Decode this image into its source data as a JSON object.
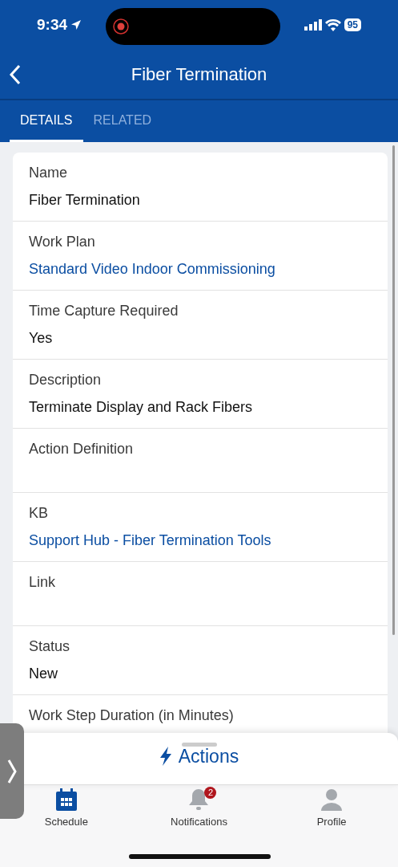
{
  "status_bar": {
    "time": "9:34",
    "battery": "95"
  },
  "header": {
    "title": "Fiber Termination"
  },
  "tabs": [
    {
      "label": "DETAILS",
      "selected": true
    },
    {
      "label": "RELATED",
      "selected": false
    }
  ],
  "fields": [
    {
      "label": "Name",
      "value": "Fiber Termination",
      "kind": "text"
    },
    {
      "label": "Work Plan",
      "value": "Standard Video Indoor Commissioning",
      "kind": "link"
    },
    {
      "label": "Time Capture Required",
      "value": "Yes",
      "kind": "text"
    },
    {
      "label": "Description",
      "value": "Terminate Display and Rack Fibers",
      "kind": "text"
    },
    {
      "label": "Action Definition",
      "kind": "empty"
    },
    {
      "label": "KB",
      "value": "Support Hub - Fiber Termination Tools",
      "kind": "link"
    },
    {
      "label": "Link",
      "kind": "empty"
    },
    {
      "label": "Status",
      "value": "New",
      "kind": "text"
    },
    {
      "label": "Work Step Duration (in Minutes)",
      "kind": "empty"
    }
  ],
  "actions": {
    "label": "Actions"
  },
  "bottom_nav": [
    {
      "label": "Schedule",
      "selected": true
    },
    {
      "label": "Notifications",
      "selected": false,
      "badge": "2"
    },
    {
      "label": "Profile",
      "selected": false
    }
  ]
}
